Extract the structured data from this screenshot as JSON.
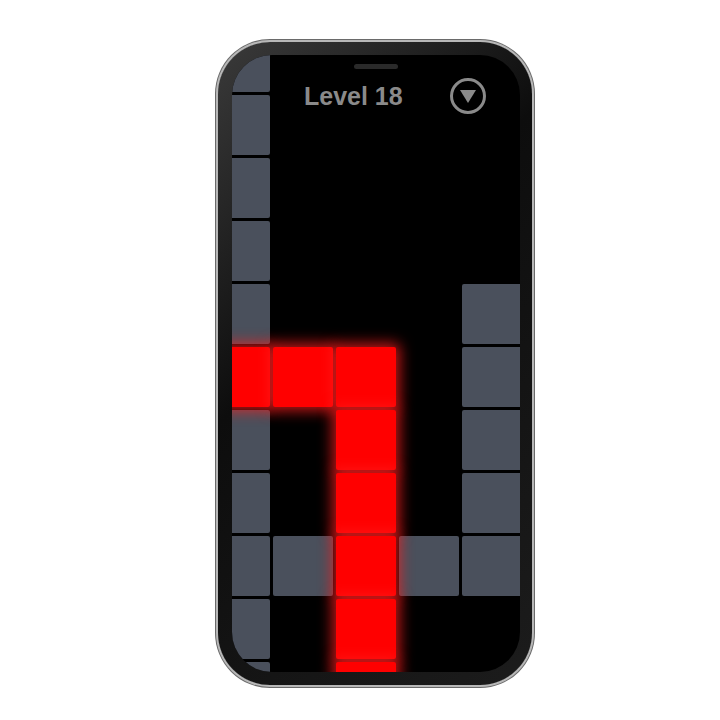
{
  "header": {
    "title": "Level 18"
  },
  "board": {
    "rows": [
      {
        "cells": [
          {
            "kind": "wall"
          },
          {
            "kind": "empty"
          },
          {
            "kind": "empty"
          },
          {
            "kind": "empty"
          },
          {
            "kind": "empty"
          }
        ]
      },
      {
        "cells": [
          {
            "kind": "wall"
          },
          {
            "kind": "empty"
          },
          {
            "kind": "empty"
          },
          {
            "kind": "empty"
          },
          {
            "kind": "empty"
          }
        ]
      },
      {
        "cells": [
          {
            "kind": "wall"
          },
          {
            "kind": "empty"
          },
          {
            "kind": "empty"
          },
          {
            "kind": "empty"
          },
          {
            "kind": "empty"
          }
        ]
      },
      {
        "cells": [
          {
            "kind": "wall"
          },
          {
            "kind": "empty"
          },
          {
            "kind": "empty"
          },
          {
            "kind": "empty"
          },
          {
            "kind": "empty"
          }
        ]
      },
      {
        "cells": [
          {
            "kind": "wall"
          },
          {
            "kind": "empty"
          },
          {
            "kind": "empty"
          },
          {
            "kind": "empty"
          },
          {
            "kind": "wall"
          }
        ]
      },
      {
        "cells": [
          {
            "kind": "lit"
          },
          {
            "kind": "lit"
          },
          {
            "kind": "lit"
          },
          {
            "kind": "empty"
          },
          {
            "kind": "wall"
          }
        ]
      },
      {
        "cells": [
          {
            "kind": "wall"
          },
          {
            "kind": "empty"
          },
          {
            "kind": "lit"
          },
          {
            "kind": "empty"
          },
          {
            "kind": "wall"
          }
        ]
      },
      {
        "cells": [
          {
            "kind": "wall"
          },
          {
            "kind": "empty"
          },
          {
            "kind": "lit"
          },
          {
            "kind": "empty"
          },
          {
            "kind": "wall"
          }
        ]
      },
      {
        "cells": [
          {
            "kind": "wall"
          },
          {
            "kind": "wall"
          },
          {
            "kind": "lit"
          },
          {
            "kind": "wall"
          },
          {
            "kind": "wall"
          }
        ]
      },
      {
        "cells": [
          {
            "kind": "wall"
          },
          {
            "kind": "empty"
          },
          {
            "kind": "lit"
          },
          {
            "kind": "empty"
          },
          {
            "kind": "empty"
          }
        ]
      },
      {
        "cells": [
          {
            "kind": "wall"
          },
          {
            "kind": "empty"
          },
          {
            "kind": "lit"
          },
          {
            "kind": "empty"
          },
          {
            "kind": "empty"
          }
        ]
      }
    ]
  }
}
